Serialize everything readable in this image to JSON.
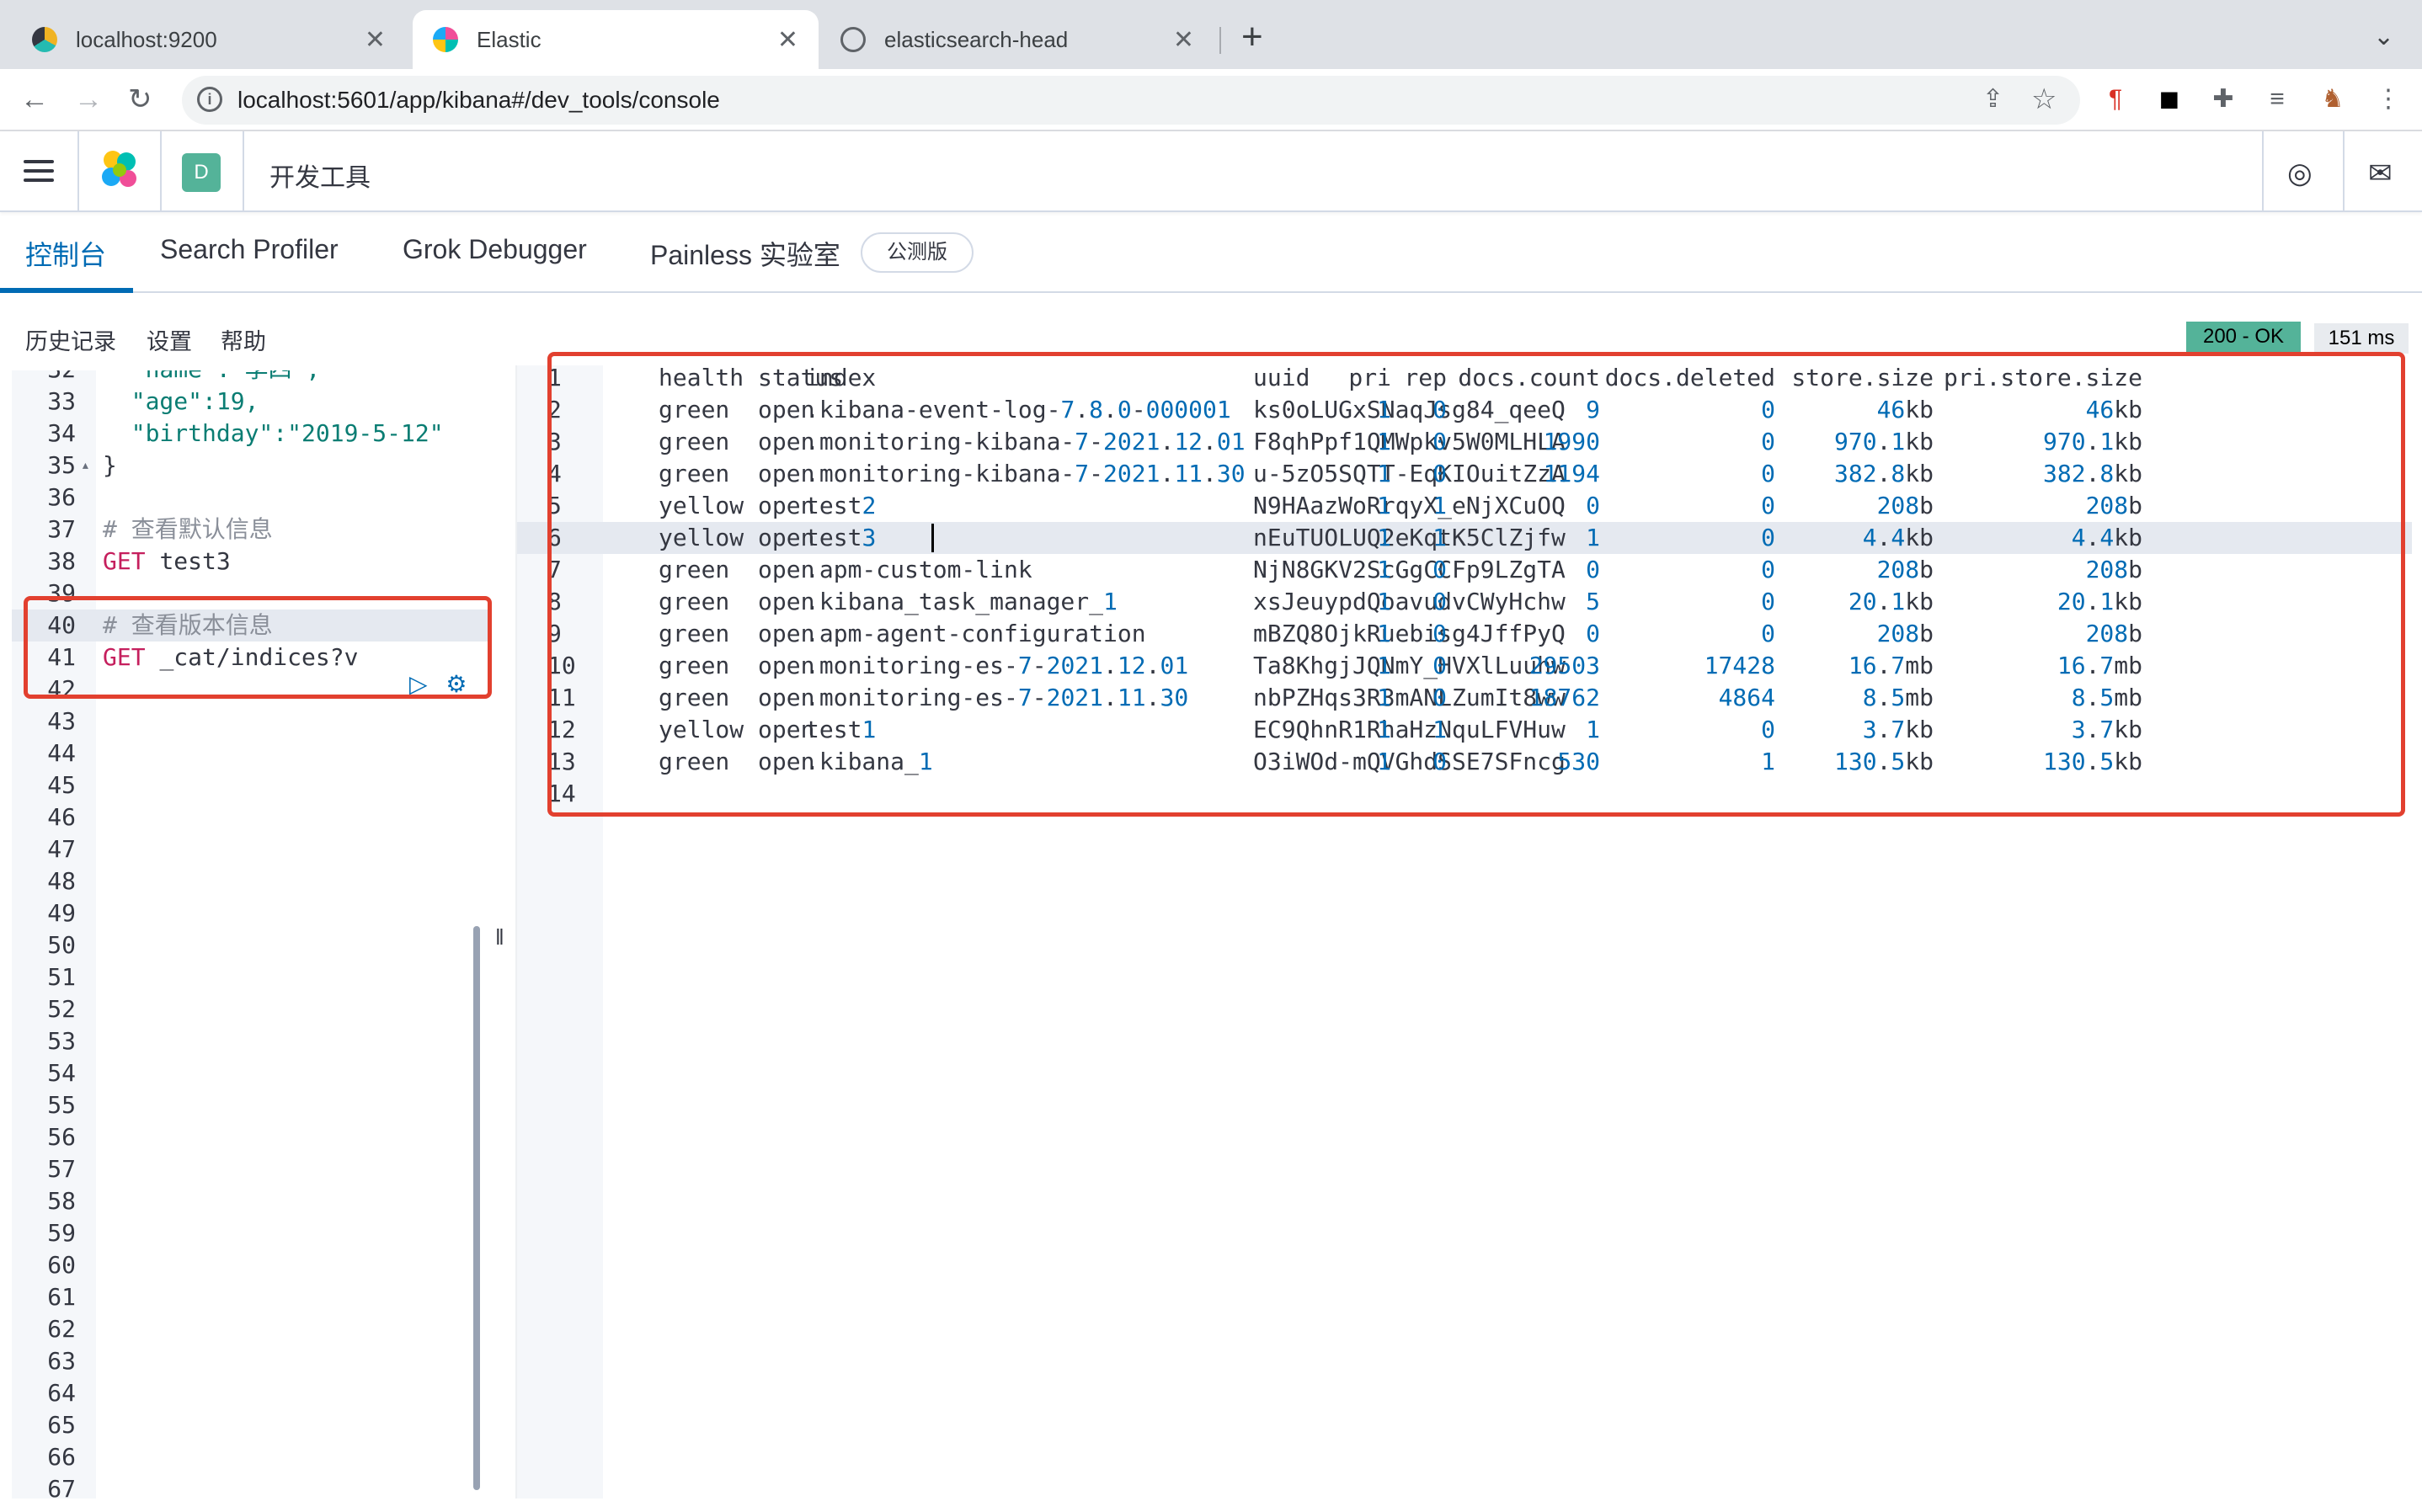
{
  "browser": {
    "tabs": [
      {
        "title": "localhost:9200"
      },
      {
        "title": "Elastic"
      },
      {
        "title": "elasticsearch-head"
      }
    ],
    "url": "localhost:5601/app/kibana#/dev_tools/console"
  },
  "app": {
    "space_initial": "D",
    "title": "开发工具"
  },
  "devtools_tabs": [
    "控制台",
    "Search Profiler",
    "Grok Debugger",
    "Painless 实验室"
  ],
  "beta_label": "公测版",
  "console_menu": [
    "历史记录",
    "设置",
    "帮助"
  ],
  "response_status": "200 - OK",
  "response_time": "151 ms",
  "editor": {
    "lines": [
      {
        "n": "32",
        "code": "  \"name\":\"李四\","
      },
      {
        "n": "33",
        "code": "  \"age\":19,"
      },
      {
        "n": "34",
        "code": "  \"birthday\":\"2019-5-12\""
      },
      {
        "n": "35",
        "code": "}"
      },
      {
        "n": "36",
        "code": ""
      },
      {
        "n": "37",
        "code": "# 查看默认信息"
      },
      {
        "n": "38",
        "code": "GET test3"
      },
      {
        "n": "39",
        "code": ""
      },
      {
        "n": "40",
        "code": "# 查看版本信息"
      },
      {
        "n": "41",
        "code": "GET _cat/indices?v"
      },
      {
        "n": "42",
        "code": ""
      },
      {
        "n": "43"
      },
      {
        "n": "44"
      },
      {
        "n": "45"
      },
      {
        "n": "46"
      },
      {
        "n": "47"
      },
      {
        "n": "48"
      },
      {
        "n": "49"
      },
      {
        "n": "50"
      },
      {
        "n": "51"
      },
      {
        "n": "52"
      },
      {
        "n": "53"
      },
      {
        "n": "54"
      },
      {
        "n": "55"
      },
      {
        "n": "56"
      },
      {
        "n": "57"
      },
      {
        "n": "58"
      },
      {
        "n": "59"
      },
      {
        "n": "60"
      },
      {
        "n": "61"
      },
      {
        "n": "62"
      },
      {
        "n": "63"
      },
      {
        "n": "64"
      },
      {
        "n": "65"
      },
      {
        "n": "66"
      },
      {
        "n": "67"
      }
    ]
  },
  "output": {
    "header": [
      "health",
      "status",
      "index",
      "uuid",
      "pri",
      "rep",
      "docs.count",
      "docs.deleted",
      "store.size",
      "pri.store.size"
    ],
    "rows": [
      [
        "green",
        "open",
        ".kibana-event-log-7.8.0-000001",
        "ks0oLUGxSNaqJsg84_qeeQ",
        "1",
        "0",
        "9",
        "0",
        "46kb",
        "46kb"
      ],
      [
        "green",
        "open",
        ".monitoring-kibana-7-2021.12.01",
        "F8qhPpf1QMWpkv5W0MLHLA",
        "1",
        "0",
        "1990",
        "0",
        "970.1kb",
        "970.1kb"
      ],
      [
        "green",
        "open",
        ".monitoring-kibana-7-2021.11.30",
        "u-5zO5SQTT-EqKIOuitZzA",
        "1",
        "0",
        "1194",
        "0",
        "382.8kb",
        "382.8kb"
      ],
      [
        "yellow",
        "open",
        "test2",
        "N9HAazWoRrqyX_eNjXCuOQ",
        "1",
        "1",
        "0",
        "0",
        "208b",
        "208b"
      ],
      [
        "yellow",
        "open",
        "test3",
        "nEuTUOLUQ2eKqtK5ClZjfw",
        "1",
        "1",
        "1",
        "0",
        "4.4kb",
        "4.4kb"
      ],
      [
        "green",
        "open",
        ".apm-custom-link",
        "NjN8GKV2ScGgCCFp9LZgTA",
        "1",
        "0",
        "0",
        "0",
        "208b",
        "208b"
      ],
      [
        "green",
        "open",
        ".kibana_task_manager_1",
        "xsJeuypdQoavudvCWyHchw",
        "1",
        "0",
        "5",
        "0",
        "20.1kb",
        "20.1kb"
      ],
      [
        "green",
        "open",
        ".apm-agent-configuration",
        "mBZQ8OjkRuebisg4JffPyQ",
        "1",
        "0",
        "0",
        "0",
        "208b",
        "208b"
      ],
      [
        "green",
        "open",
        ".monitoring-es-7-2021.12.01",
        "Ta8KhgjJQNmY_HVXlLuuhw",
        "1",
        "0",
        "29503",
        "17428",
        "16.7mb",
        "16.7mb"
      ],
      [
        "green",
        "open",
        ".monitoring-es-7-2021.11.30",
        "nbPZHqs3R3mANLZumIt8ww",
        "1",
        "0",
        "18762",
        "4864",
        "8.5mb",
        "8.5mb"
      ],
      [
        "yellow",
        "open",
        "test1",
        "EC9QhnR1RhaHzNquLFVHuw",
        "1",
        "1",
        "1",
        "0",
        "3.7kb",
        "3.7kb"
      ],
      [
        "green",
        "open",
        ".kibana_1",
        "O3iWOd-mQVGhdSSE7SFncg",
        "1",
        "0",
        "530",
        "1",
        "130.5kb",
        "130.5kb"
      ]
    ]
  },
  "colors": {
    "accent": "#006bb4",
    "status_ok": "#54b399",
    "annotation_red": "#e2402f"
  },
  "icons": {
    "nav": [
      "back-icon",
      "forward-icon",
      "reload-icon"
    ],
    "extensions": [
      "pilcrow-icon",
      "bear-icon",
      "puzzle-icon",
      "queue-icon",
      "profile-icon",
      "kebab-menu-icon"
    ],
    "header": [
      "help-icon",
      "mail-icon"
    ],
    "editor_actions": [
      "play-icon",
      "wrench-icon"
    ]
  }
}
